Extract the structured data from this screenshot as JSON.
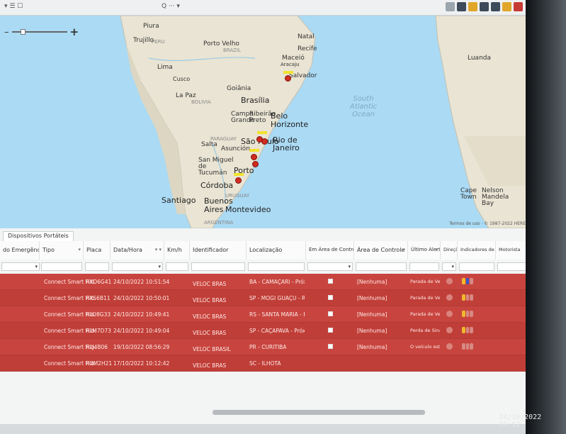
{
  "toolbar": {
    "search_label": "Q ··· ▾"
  },
  "map": {
    "zoom_plus": "+",
    "zoom_minus": "–",
    "cities": [
      {
        "id": "piura",
        "label": "Piura",
        "big": false
      },
      {
        "id": "trujillo",
        "label": "Trujillo",
        "big": false
      },
      {
        "id": "peru",
        "label": "PERU",
        "big": false
      },
      {
        "id": "portovelho",
        "label": "Porto Velho",
        "big": false
      },
      {
        "id": "brazil",
        "label": "BRAZIL",
        "big": false
      },
      {
        "id": "natal",
        "label": "Natal",
        "big": false
      },
      {
        "id": "recife",
        "label": "Recife",
        "big": false
      },
      {
        "id": "maceio",
        "label": "Maceió",
        "big": false
      },
      {
        "id": "aracaju",
        "label": "Aracaju",
        "big": false
      },
      {
        "id": "salvador",
        "label": "Salvador",
        "big": false
      },
      {
        "id": "lima",
        "label": "Lima",
        "big": false
      },
      {
        "id": "cusco",
        "label": "Cusco",
        "big": false
      },
      {
        "id": "lapaz",
        "label": "La Paz",
        "big": false
      },
      {
        "id": "bolivia",
        "label": "BOLIVIA",
        "big": false
      },
      {
        "id": "goiania",
        "label": "Goiânia",
        "big": false
      },
      {
        "id": "brasilia",
        "label": "Brasília",
        "big": true
      },
      {
        "id": "campogrande",
        "label": "Campo Grande",
        "big": false
      },
      {
        "id": "ribeirao",
        "label": "Ribeirão Preto",
        "big": false
      },
      {
        "id": "belo",
        "label": "Belo Horizonte",
        "big": true
      },
      {
        "id": "paraguay",
        "label": "PARAGUAY",
        "big": false
      },
      {
        "id": "saopaulo",
        "label": "São Paulo",
        "big": true
      },
      {
        "id": "rio",
        "label": "Rio de Janeiro",
        "big": true
      },
      {
        "id": "salta",
        "label": "Salta",
        "big": false
      },
      {
        "id": "asuncion",
        "label": "Asunción",
        "big": false
      },
      {
        "id": "tucuman",
        "label": "San Miguel de Tucumán",
        "big": false
      },
      {
        "id": "porto",
        "label": "Porto",
        "big": true
      },
      {
        "id": "cordoba",
        "label": "Córdoba",
        "big": true
      },
      {
        "id": "santiago",
        "label": "Santiago",
        "big": true
      },
      {
        "id": "buenos",
        "label": "Buenos Aires",
        "big": true
      },
      {
        "id": "uruguay",
        "label": "URUGUAY",
        "big": false
      },
      {
        "id": "montevideo",
        "label": "Montevideo",
        "big": true
      },
      {
        "id": "argentina",
        "label": "ARGENTINA",
        "big": false
      },
      {
        "id": "luanda",
        "label": "Luanda",
        "big": false
      },
      {
        "id": "capetown",
        "label": "Cape Town",
        "big": false
      },
      {
        "id": "nelson",
        "label": "Nelson Mandela Bay",
        "big": false
      }
    ],
    "ocean_label": "South Atlantic Ocean",
    "attribution": "Termos de uso · © 1987-2022 HERE"
  },
  "panel": {
    "tab_label": "Dispositivos Portáteis"
  },
  "columns": {
    "emergencia": "do Emergência",
    "tipo": "Tipo",
    "placa": "Placa",
    "datahora": "Data/Hora",
    "kmh": "Km/h",
    "identificador": "Identificador",
    "localizacao": "Localização",
    "em_area": "Em Área de Controle?",
    "area": "Área de Controle",
    "ultimo_alerta": "Último Alerta",
    "direcao": "Direção",
    "indicadores": "Indicadores de Viagem",
    "motorista": "Motorista"
  },
  "rows": [
    {
      "tipo": "Connect Smart Hib.",
      "placa": "RXD6G41",
      "datahora": "24/10/2022 10:51:54",
      "identificador": "VELOC BRAS",
      "localizacao": "BA - CAMAÇARI - Próx. Via de Li",
      "area": "[Nenhuma]",
      "alerta": "Parada de Veículo"
    },
    {
      "tipo": "Connect Smart Hib.",
      "placa": "RXS6B11",
      "datahora": "24/10/2022 10:50:01",
      "identificador": "VELOC BRAS",
      "localizacao": "SP - MOGI GUAÇU - Rua Antônio",
      "area": "[Nenhuma]",
      "alerta": "Parada de Veículo"
    },
    {
      "tipo": "Connect Smart Hib.",
      "placa": "RLO8G33",
      "datahora": "24/10/2022 10:49:41",
      "identificador": "VELOC BRAS",
      "localizacao": "RS - SANTA MARIA - Próx. Rua C",
      "area": "[Nenhuma]",
      "alerta": "Parada de Veículo"
    },
    {
      "tipo": "Connect Smart Hib.",
      "placa": "RLM7D73",
      "datahora": "24/10/2022 10:49:04",
      "identificador": "VELOC BRAS",
      "localizacao": "SP - CAÇAPAVA - Próx. Avenida",
      "area": "[Nenhuma]",
      "alerta": "Perda de Sinal"
    },
    {
      "tipo": "Connect Smart Hib.",
      "placa": "RLJ4B06",
      "datahora": "19/10/2022 08:56:29",
      "identificador": "VELOC BRASIL",
      "localizacao": "PR - CURITIBA",
      "area": "[Nenhuma]",
      "alerta": "O veículo está liga"
    },
    {
      "tipo": "Connect Smart Hib.",
      "placa": "RUM2H21",
      "datahora": "17/10/2022 10:12:42",
      "identificador": "VELOC BRAS",
      "localizacao": "SC - ILHOTA",
      "area": "",
      "alerta": ""
    }
  ],
  "clock": "24/10/2022 10:52",
  "colors": {
    "row_red": "#c8453f",
    "map_water": "#aadaf4",
    "map_land": "#e9e4d3",
    "marker": "#d12b1f"
  }
}
